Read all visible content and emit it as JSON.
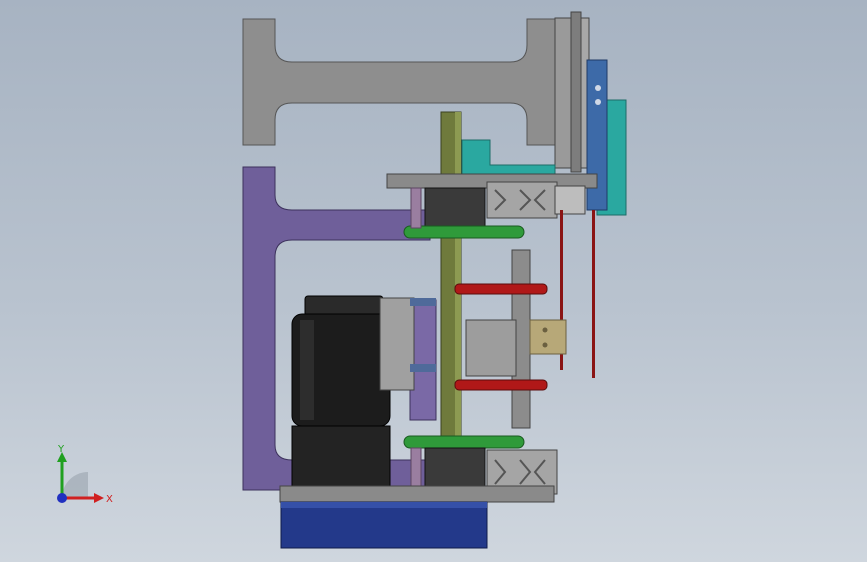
{
  "viewport": {
    "background_top": "#a7b3c2",
    "background_bottom": "#cfd6de"
  },
  "colors": {
    "frame_gray": "#8e8e8e",
    "frame_edge": "#555555",
    "purple_plate": "#6f5f9a",
    "motor_black": "#1c1c1c",
    "base_blue": "#23398a",
    "belt_green": "#2f9a3a",
    "shaft_olive": "#6f7a3c",
    "teal_bracket": "#2aa8a0",
    "blue_block": "#3d6aa8",
    "red_pin": "#b01818",
    "tan_plate": "#b7a878",
    "axis_x": "#d02020",
    "axis_y": "#20a020",
    "axis_z": "#2030c0"
  },
  "triad": {
    "x_label": "X",
    "y_label": "Y",
    "x_icon": "axis-x-arrow",
    "y_icon": "axis-y-arrow",
    "z_icon": "axis-z-dot"
  }
}
